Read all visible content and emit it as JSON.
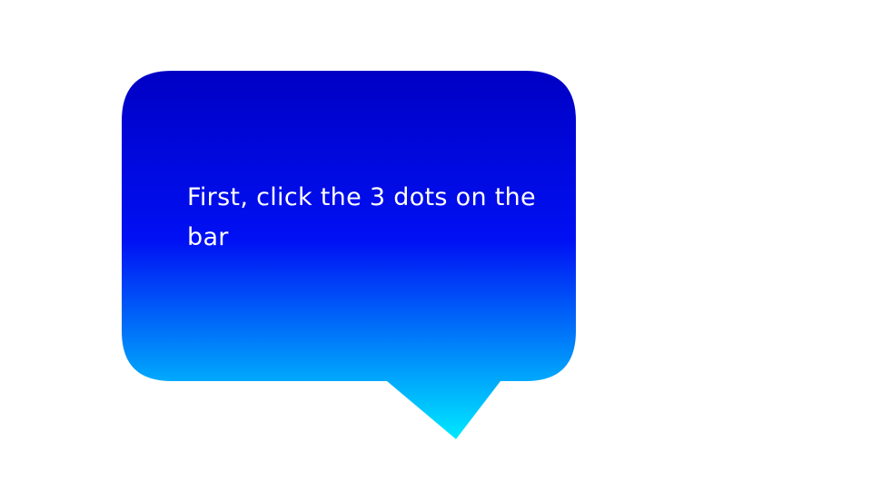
{
  "slide": {
    "background_color": "#ffffff"
  },
  "speech_bubble": {
    "text": "First, click the 3 dots on the bar",
    "text_color": "#ffffff",
    "gradient": {
      "top_color": "#0000c4",
      "middle_color": "#0010f4",
      "bottom_color": "#00e8ff"
    }
  }
}
